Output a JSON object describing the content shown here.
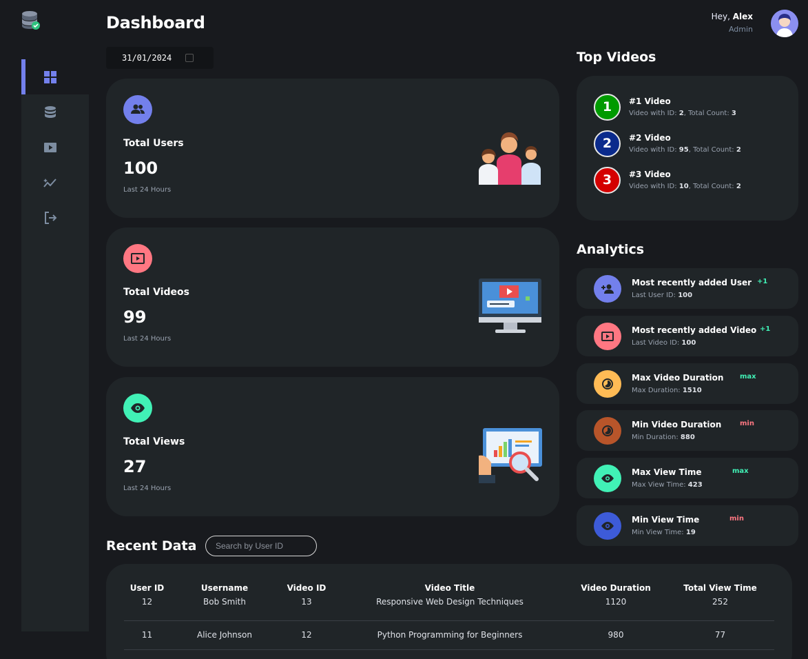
{
  "header": {
    "title": "Dashboard",
    "date": "31/01/2024",
    "greeting": "Hey,",
    "user_name": "Alex",
    "user_role": "Admin"
  },
  "sidebar": {
    "items": [
      {
        "icon": "grid-icon",
        "active": true
      },
      {
        "icon": "database-icon",
        "active": false
      },
      {
        "icon": "video-icon",
        "active": false
      },
      {
        "icon": "analytics-icon",
        "active": false
      },
      {
        "icon": "logout-icon",
        "active": false
      }
    ]
  },
  "stats": [
    {
      "label": "Total Users",
      "value": "100",
      "sub": "Last 24 Hours",
      "icon": "users-icon",
      "color": "#7380ec"
    },
    {
      "label": "Total Videos",
      "value": "99",
      "sub": "Last 24 Hours",
      "icon": "video-icon",
      "color": "#ff7782"
    },
    {
      "label": "Total Views",
      "value": "27",
      "sub": "Last 24 Hours",
      "icon": "eye-icon",
      "color": "#41f1b6"
    }
  ],
  "top_videos": {
    "title": "Top Videos",
    "items": [
      {
        "rank": "1",
        "title": "#1 Video",
        "id_prefix": "Video with ID: ",
        "id": "2",
        "count_prefix": ", Total Count: ",
        "count": "3",
        "color": "#009a00"
      },
      {
        "rank": "2",
        "title": "#2 Video",
        "id_prefix": "Video with ID: ",
        "id": "95",
        "count_prefix": ", Total Count: ",
        "count": "2",
        "color": "#0a2a8c"
      },
      {
        "rank": "3",
        "title": "#3 Video",
        "id_prefix": "Video with ID: ",
        "id": "10",
        "count_prefix": ", Total Count: ",
        "count": "2",
        "color": "#d40000"
      }
    ]
  },
  "analytics": {
    "title": "Analytics",
    "items": [
      {
        "title": "Most recently added User",
        "sub_label": "Last User ID: ",
        "sub_value": "100",
        "tag": "+1",
        "tag_color": "#41f1b6",
        "icon": "add-user-icon",
        "color": "#7380ec"
      },
      {
        "title": "Most recently added Video",
        "sub_label": "Last Video ID: ",
        "sub_value": "100",
        "tag": "+1",
        "tag_color": "#41f1b6",
        "icon": "video-icon",
        "color": "#ff7782"
      },
      {
        "title": "Max Video Duration",
        "sub_label": "Max Duration: ",
        "sub_value": "1510",
        "tag": "max",
        "tag_color": "#41f1b6",
        "icon": "timer-icon",
        "color": "#ffbb55"
      },
      {
        "title": "Min Video Duration",
        "sub_label": "Min Duration: ",
        "sub_value": "880",
        "tag": "min",
        "tag_color": "#ff7782",
        "icon": "timer-icon",
        "color": "#b8552a"
      },
      {
        "title": "Max View Time",
        "sub_label": "Max View Time: ",
        "sub_value": "423",
        "tag": "max",
        "tag_color": "#41f1b6",
        "icon": "eye-icon",
        "color": "#41f1b6"
      },
      {
        "title": "Min View Time",
        "sub_label": "Min View Time: ",
        "sub_value": "19",
        "tag": "min",
        "tag_color": "#ff7782",
        "icon": "eye-icon",
        "color": "#3d5bd8"
      }
    ]
  },
  "recent": {
    "title": "Recent Data",
    "search_placeholder": "Search by User ID",
    "columns": [
      "User ID",
      "Username",
      "Video ID",
      "Video Title",
      "Video Duration",
      "Total View Time"
    ],
    "rows": [
      [
        "12",
        "Bob Smith",
        "13",
        "Responsive Web Design Techniques",
        "1120",
        "252"
      ],
      [
        "11",
        "Alice Johnson",
        "12",
        "Python Programming for Beginners",
        "980",
        "77"
      ]
    ]
  }
}
